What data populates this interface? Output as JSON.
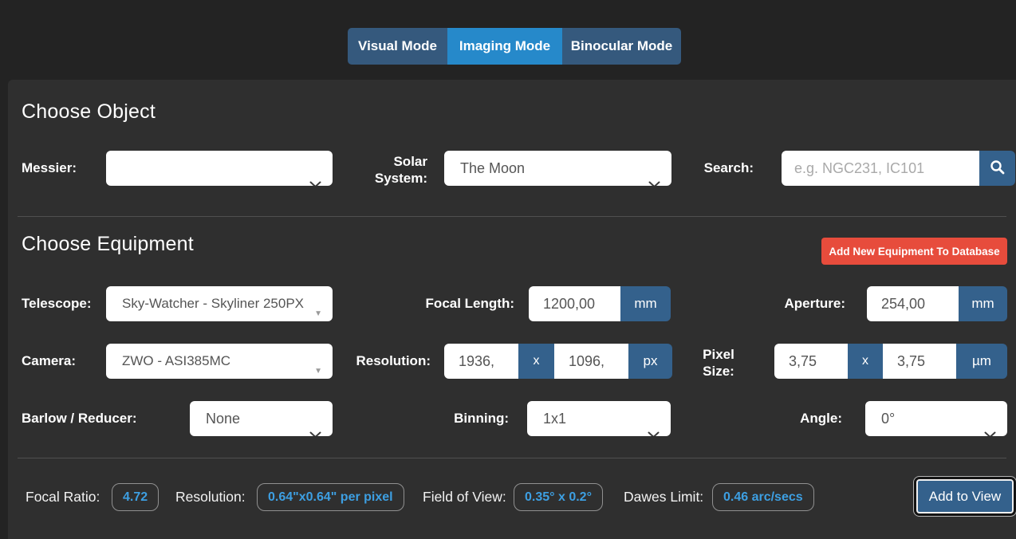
{
  "tabs": {
    "visual": "Visual Mode",
    "imaging": "Imaging Mode",
    "binocular": "Binocular Mode"
  },
  "object": {
    "heading": "Choose Object",
    "messier_label": "Messier:",
    "messier_value": "",
    "solar_label": "Solar System:",
    "solar_value": "The Moon",
    "search_label": "Search:",
    "search_placeholder": "e.g. NGC231, IC101"
  },
  "equipment": {
    "heading": "Choose Equipment",
    "add_button": "Add New Equipment To Database",
    "telescope_label": "Telescope:",
    "telescope_value": "Sky-Watcher - Skyliner 250PX",
    "focal_length_label": "Focal Length:",
    "focal_length_value": "1200,00",
    "focal_length_unit": "mm",
    "aperture_label": "Aperture:",
    "aperture_value": "254,00",
    "aperture_unit": "mm",
    "camera_label": "Camera:",
    "camera_value": "ZWO - ASI385MC",
    "resolution_label": "Resolution:",
    "resolution_x_value": "1936,",
    "resolution_separator": "x",
    "resolution_y_value": "1096,",
    "resolution_unit": "px",
    "pixel_size_label": "Pixel Size:",
    "pixel_x_value": "3,75",
    "pixel_separator": "x",
    "pixel_y_value": "3,75",
    "pixel_unit": "µm",
    "barlow_label": "Barlow / Reducer:",
    "barlow_value": "None",
    "binning_label": "Binning:",
    "binning_value": "1x1",
    "angle_label": "Angle:",
    "angle_value": "0°"
  },
  "results": {
    "focal_ratio_label": "Focal Ratio:",
    "focal_ratio_value": "4.72",
    "resolution_label": "Resolution:",
    "resolution_value": "0.64\"x0.64\" per pixel",
    "fov_label": "Field of View:",
    "fov_value": "0.35° x 0.2°",
    "dawes_label": "Dawes Limit:",
    "dawes_value": "0.46 arc/secs",
    "add_to_view_button": "Add to View"
  },
  "colors": {
    "active_tab": "#2689ca",
    "steel_blue": "#34618c",
    "danger_red": "#e74c3c",
    "result_blue": "#3d9fe2"
  }
}
